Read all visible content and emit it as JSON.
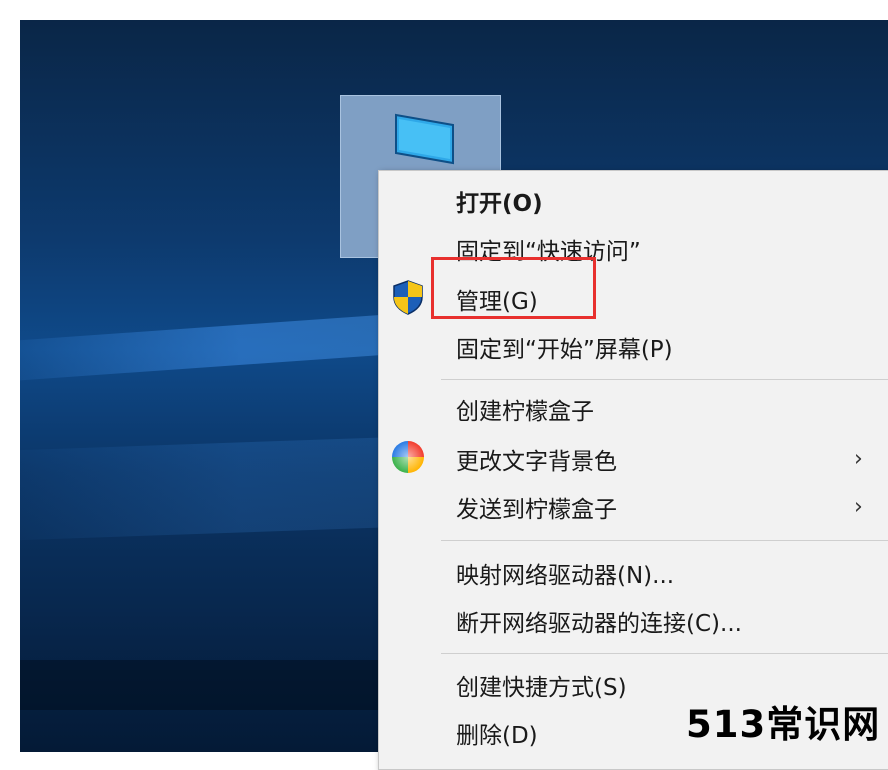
{
  "desktop_icon": {
    "name": "this-pc-icon"
  },
  "context_menu": {
    "items": [
      {
        "label": "打开(O)",
        "bold": true
      },
      {
        "label": "固定到“快速访问”"
      },
      {
        "label": "管理(G)",
        "icon": "uac-shield-icon"
      },
      {
        "label": "固定到“开始”屏幕(P)"
      },
      {
        "label": "创建柠檬盒子"
      },
      {
        "label": "更改文字背景色",
        "icon": "color-wheel-icon",
        "submenu": true
      },
      {
        "label": "发送到柠檬盒子",
        "submenu": true
      },
      {
        "label": "映射网络驱动器(N)..."
      },
      {
        "label": "断开网络驱动器的连接(C)..."
      },
      {
        "label": "创建快捷方式(S)"
      },
      {
        "label": "删除(D)"
      }
    ],
    "submenu_glyph": "›"
  },
  "annotation": {
    "highlight_color": "#e8302e"
  },
  "watermark": {
    "text": "513常识网"
  }
}
